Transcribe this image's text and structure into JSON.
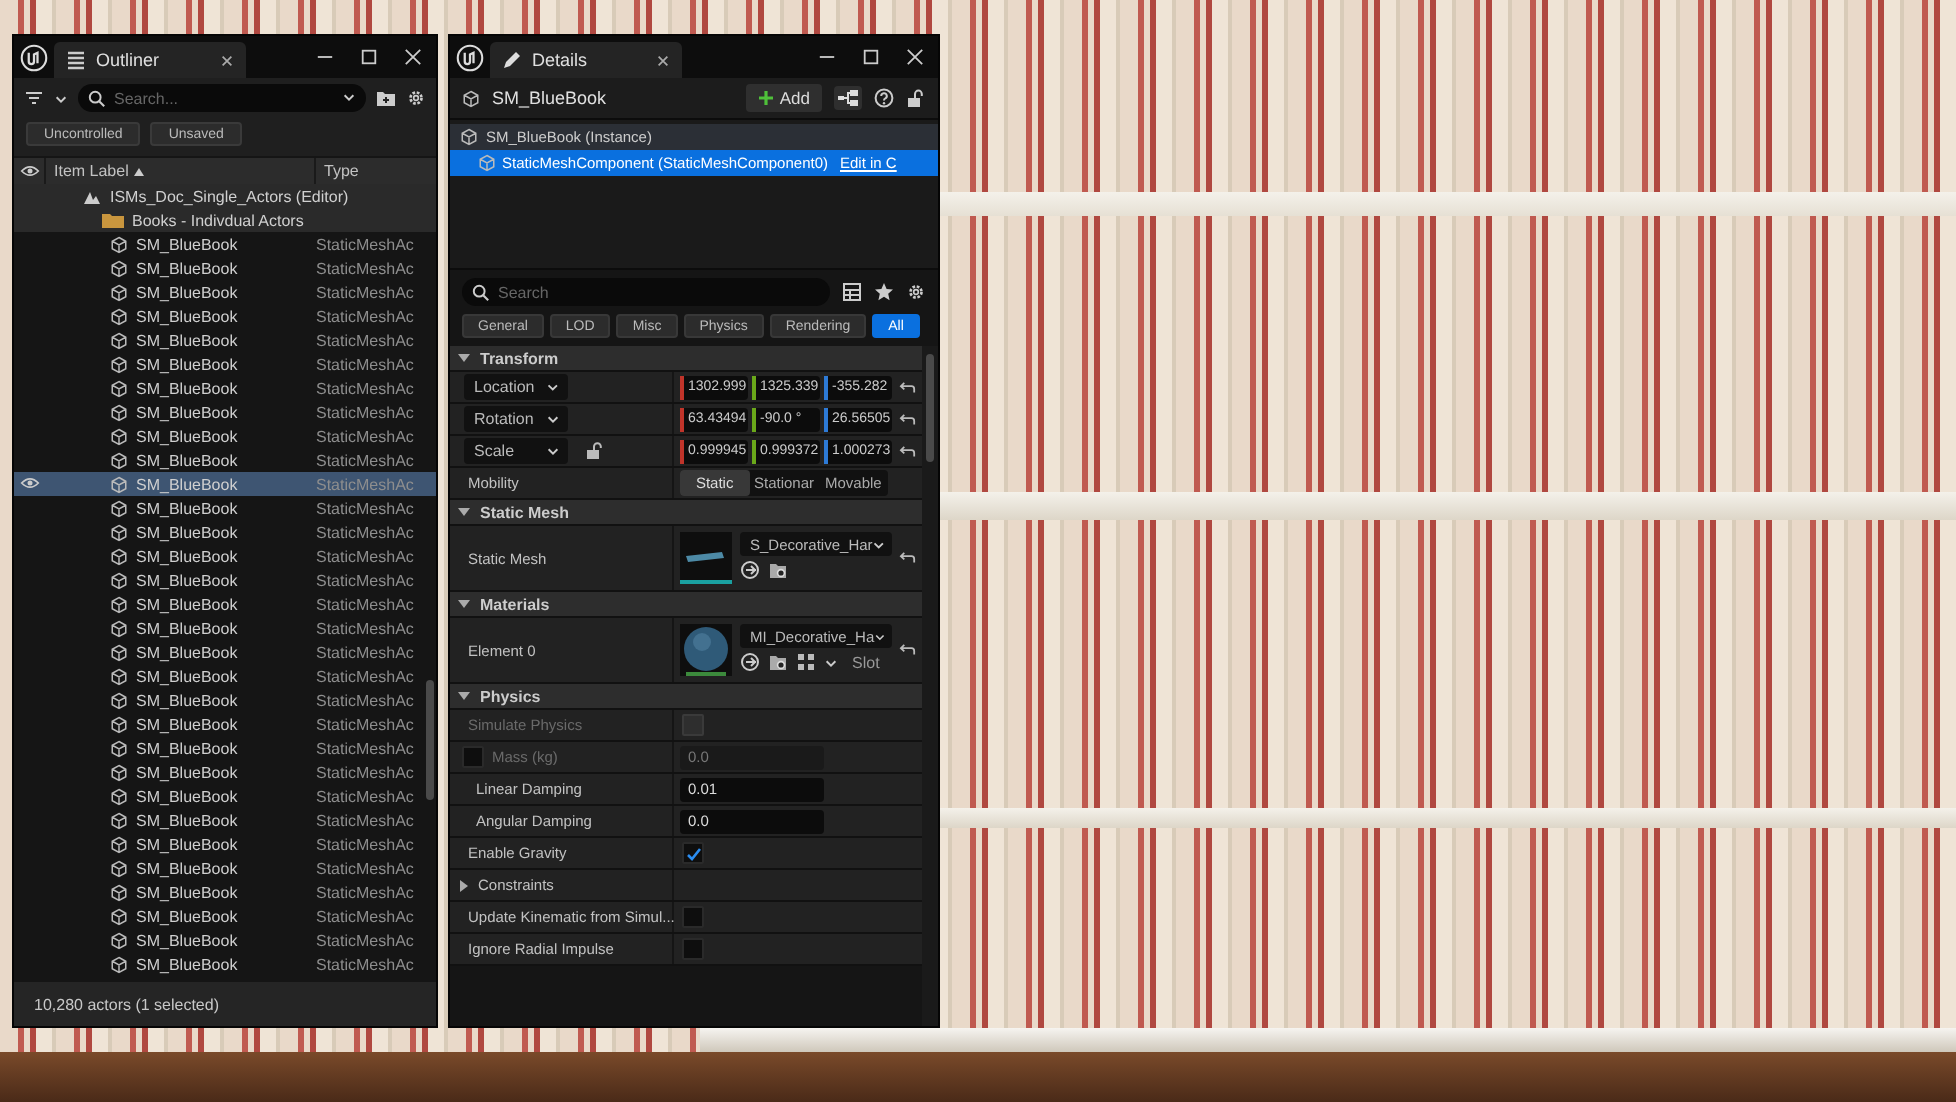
{
  "outliner": {
    "tab_title": "Outliner",
    "search_placeholder": "Search...",
    "chips": [
      "Uncontrolled",
      "Unsaved"
    ],
    "columns": [
      "Item Label",
      "Type"
    ],
    "tree": [
      {
        "label": "ISMs_Doc_Single_Actors (Editor)",
        "kind": "level",
        "children": [
          {
            "label": "Books - Indivdual Actors",
            "kind": "folder",
            "children": [
              {
                "label": "SM_BlueBook",
                "type": "StaticMeshAc",
                "selected": false
              },
              {
                "label": "SM_BlueBook",
                "type": "StaticMeshAc",
                "selected": false
              },
              {
                "label": "SM_BlueBook",
                "type": "StaticMeshAc",
                "selected": false
              },
              {
                "label": "SM_BlueBook",
                "type": "StaticMeshAc",
                "selected": false
              },
              {
                "label": "SM_BlueBook",
                "type": "StaticMeshAc",
                "selected": false
              },
              {
                "label": "SM_BlueBook",
                "type": "StaticMeshAc",
                "selected": false
              },
              {
                "label": "SM_BlueBook",
                "type": "StaticMeshAc",
                "selected": false
              },
              {
                "label": "SM_BlueBook",
                "type": "StaticMeshAc",
                "selected": false
              },
              {
                "label": "SM_BlueBook",
                "type": "StaticMeshAc",
                "selected": false
              },
              {
                "label": "SM_BlueBook",
                "type": "StaticMeshAc",
                "selected": false
              },
              {
                "label": "SM_BlueBook",
                "type": "StaticMeshAc",
                "selected": true
              },
              {
                "label": "SM_BlueBook",
                "type": "StaticMeshAc",
                "selected": false
              },
              {
                "label": "SM_BlueBook",
                "type": "StaticMeshAc",
                "selected": false
              },
              {
                "label": "SM_BlueBook",
                "type": "StaticMeshAc",
                "selected": false
              },
              {
                "label": "SM_BlueBook",
                "type": "StaticMeshAc",
                "selected": false
              },
              {
                "label": "SM_BlueBook",
                "type": "StaticMeshAc",
                "selected": false
              },
              {
                "label": "SM_BlueBook",
                "type": "StaticMeshAc",
                "selected": false
              },
              {
                "label": "SM_BlueBook",
                "type": "StaticMeshAc",
                "selected": false
              },
              {
                "label": "SM_BlueBook",
                "type": "StaticMeshAc",
                "selected": false
              },
              {
                "label": "SM_BlueBook",
                "type": "StaticMeshAc",
                "selected": false
              },
              {
                "label": "SM_BlueBook",
                "type": "StaticMeshAc",
                "selected": false
              },
              {
                "label": "SM_BlueBook",
                "type": "StaticMeshAc",
                "selected": false
              },
              {
                "label": "SM_BlueBook",
                "type": "StaticMeshAc",
                "selected": false
              },
              {
                "label": "SM_BlueBook",
                "type": "StaticMeshAc",
                "selected": false
              },
              {
                "label": "SM_BlueBook",
                "type": "StaticMeshAc",
                "selected": false
              },
              {
                "label": "SM_BlueBook",
                "type": "StaticMeshAc",
                "selected": false
              },
              {
                "label": "SM_BlueBook",
                "type": "StaticMeshAc",
                "selected": false
              },
              {
                "label": "SM_BlueBook",
                "type": "StaticMeshAc",
                "selected": false
              },
              {
                "label": "SM_BlueBook",
                "type": "StaticMeshAc",
                "selected": false
              },
              {
                "label": "SM_BlueBook",
                "type": "StaticMeshAc",
                "selected": false
              },
              {
                "label": "SM_BlueBook",
                "type": "StaticMeshAc",
                "selected": false
              }
            ]
          }
        ]
      }
    ],
    "status": "10,280 actors (1 selected)"
  },
  "details": {
    "tab_title": "Details",
    "actor_name": "SM_BlueBook",
    "add_label": "Add",
    "components": [
      {
        "label": "SM_BlueBook (Instance)",
        "selected": false
      },
      {
        "label": "StaticMeshComponent (StaticMeshComponent0)",
        "selected": true,
        "link": "Edit in C"
      }
    ],
    "search_placeholder": "Search",
    "filters": [
      {
        "label": "General",
        "selected": false
      },
      {
        "label": "LOD",
        "selected": false
      },
      {
        "label": "Misc",
        "selected": false
      },
      {
        "label": "Physics",
        "selected": false
      },
      {
        "label": "Rendering",
        "selected": false
      },
      {
        "label": "All",
        "selected": true
      }
    ],
    "sections": [
      {
        "title": "Transform",
        "expanded": true,
        "rows": [
          {
            "kind": "vector",
            "label": "Location",
            "values": [
              "1302.999",
              "1325.339",
              "-355.282"
            ]
          },
          {
            "kind": "vector",
            "label": "Rotation",
            "values": [
              "63.43494",
              "-90.0 °",
              "26.56505"
            ]
          },
          {
            "kind": "vector",
            "label": "Scale",
            "locked": false,
            "values": [
              "0.999945",
              "0.999372",
              "1.000273"
            ]
          },
          {
            "kind": "segmented",
            "label": "Mobility",
            "options": [
              {
                "label": "Static",
                "selected": true
              },
              {
                "label": "Stationar",
                "selected": false
              },
              {
                "label": "Movable",
                "selected": false
              }
            ]
          }
        ]
      },
      {
        "title": "Static Mesh",
        "expanded": true,
        "rows": [
          {
            "kind": "mesh_asset",
            "label": "Static Mesh",
            "asset": "S_Decorative_Har"
          }
        ]
      },
      {
        "title": "Materials",
        "expanded": true,
        "rows": [
          {
            "kind": "material_asset",
            "label": "Element 0",
            "asset": "MI_Decorative_Ha",
            "slot_label": "Slot"
          }
        ]
      },
      {
        "title": "Physics",
        "expanded": true,
        "rows": [
          {
            "kind": "checkbox",
            "label": "Simulate Physics",
            "checked": false,
            "disabled": true
          },
          {
            "kind": "number",
            "label": "Mass (kg)",
            "value": "0.0",
            "disabled": true,
            "toggle_checked": false
          },
          {
            "kind": "number",
            "label": "Linear Damping",
            "value": "0.01",
            "disabled": false
          },
          {
            "kind": "number",
            "label": "Angular Damping",
            "value": "0.0",
            "disabled": false
          },
          {
            "kind": "checkbox",
            "label": "Enable Gravity",
            "checked": true,
            "disabled": false
          },
          {
            "kind": "group",
            "label": "Constraints",
            "expanded": false
          },
          {
            "kind": "checkbox",
            "label": "Update Kinematic from Simul...",
            "checked": false,
            "disabled": false
          },
          {
            "kind": "checkbox",
            "label": "Ignore Radial Impulse",
            "checked": false,
            "disabled": false
          }
        ]
      }
    ]
  }
}
